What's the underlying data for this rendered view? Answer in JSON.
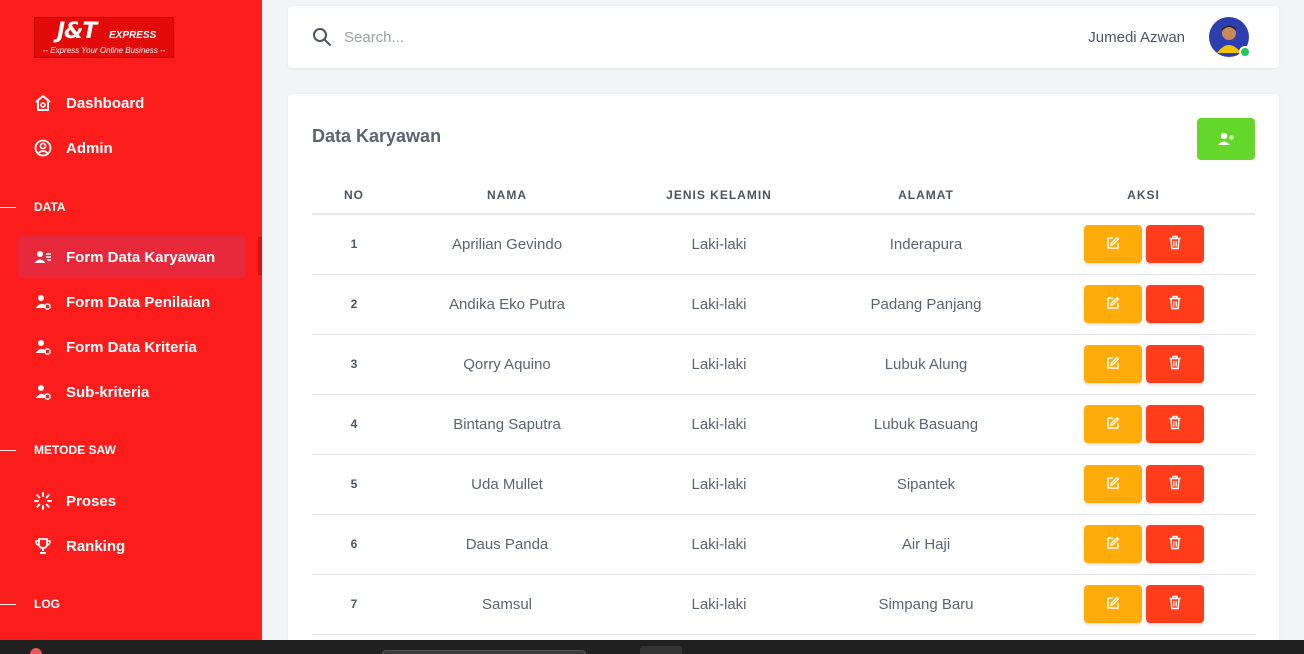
{
  "brand": {
    "logo_text": "J&T",
    "logo_express": "EXPRESS",
    "tagline": "-- Express Your Online Business --",
    "color": "#fb1c1c"
  },
  "sidebar": {
    "items_top": [
      {
        "label": "Dashboard",
        "icon": "home-icon"
      },
      {
        "label": "Admin",
        "icon": "user-circle-icon"
      }
    ],
    "section_data": "DATA",
    "items_data": [
      {
        "label": "Form Data Karyawan",
        "icon": "user-list-icon",
        "active": true
      },
      {
        "label": "Form Data Penilaian",
        "icon": "user-gear-icon"
      },
      {
        "label": "Form Data Kriteria",
        "icon": "user-gear-icon"
      },
      {
        "label": "Sub-kriteria",
        "icon": "user-gear-icon"
      }
    ],
    "section_saw": "METODE SAW",
    "items_saw": [
      {
        "label": "Proses",
        "icon": "loader-icon"
      },
      {
        "label": "Ranking",
        "icon": "trophy-icon"
      }
    ],
    "section_log": "LOG"
  },
  "topbar": {
    "search_placeholder": "Search...",
    "user_name": "Jumedi Azwan"
  },
  "main": {
    "title": "Data Karyawan",
    "columns": [
      "NO",
      "NAMA",
      "JENIS KELAMIN",
      "ALAMAT",
      "AKSI"
    ],
    "rows": [
      {
        "no": "1",
        "nama": "Aprilian Gevindo",
        "jk": "Laki-laki",
        "alamat": "Inderapura"
      },
      {
        "no": "2",
        "nama": "Andika Eko Putra",
        "jk": "Laki-laki",
        "alamat": "Padang Panjang"
      },
      {
        "no": "3",
        "nama": "Qorry Aquino",
        "jk": "Laki-laki",
        "alamat": "Lubuk Alung"
      },
      {
        "no": "4",
        "nama": "Bintang Saputra",
        "jk": "Laki-laki",
        "alamat": "Lubuk Basuang"
      },
      {
        "no": "5",
        "nama": "Uda Mullet",
        "jk": "Laki-laki",
        "alamat": "Sipantek"
      },
      {
        "no": "6",
        "nama": "Daus Panda",
        "jk": "Laki-laki",
        "alamat": "Air Haji"
      },
      {
        "no": "7",
        "nama": "Samsul",
        "jk": "Laki-laki",
        "alamat": "Simpang Baru"
      }
    ]
  },
  "colors": {
    "add_button": "#65d62a",
    "edit_button": "#ffac0a",
    "delete_button": "#ff3d1a"
  }
}
